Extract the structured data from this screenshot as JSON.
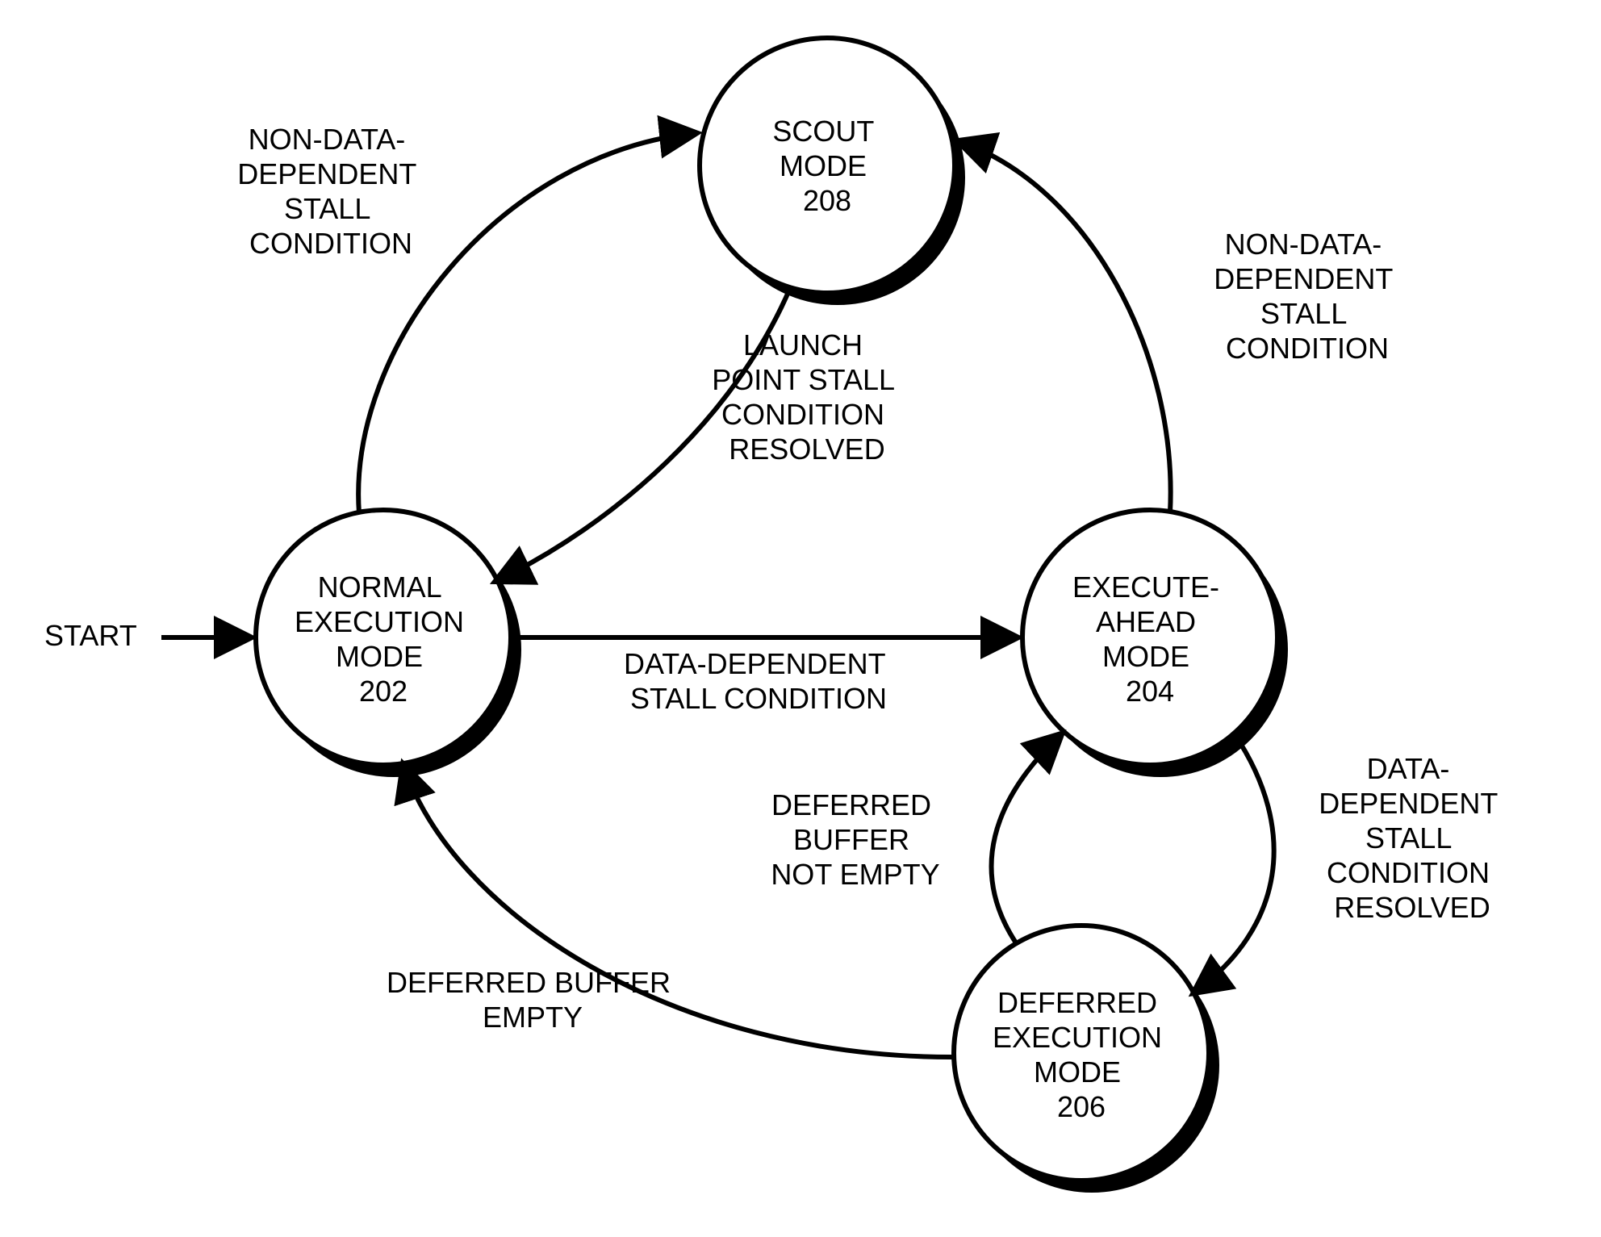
{
  "start_label": "START",
  "nodes": {
    "normal": {
      "line1": "NORMAL",
      "line2": "EXECUTION",
      "line3": "MODE",
      "line4": "202"
    },
    "execute": {
      "line1": "EXECUTE-",
      "line2": "AHEAD",
      "line3": "MODE",
      "line4": "204"
    },
    "deferred": {
      "line1": "DEFERRED",
      "line2": "EXECUTION",
      "line3": "MODE",
      "line4": "206"
    },
    "scout": {
      "line1": "SCOUT",
      "line2": "MODE",
      "line3": "208",
      "line4": ""
    }
  },
  "edges": {
    "normal_to_scout": {
      "l1": "NON-DATA-",
      "l2": "DEPENDENT",
      "l3": "STALL",
      "l4": "CONDITION"
    },
    "scout_to_normal": {
      "l1": "LAUNCH",
      "l2": "POINT STALL",
      "l3": "CONDITION",
      "l4": "RESOLVED"
    },
    "normal_to_execute": {
      "l1": "DATA-DEPENDENT",
      "l2": "STALL CONDITION",
      "l3": "",
      "l4": ""
    },
    "execute_to_scout": {
      "l1": "NON-DATA-",
      "l2": "DEPENDENT",
      "l3": "STALL",
      "l4": "CONDITION"
    },
    "execute_to_deferred": {
      "l1": "DATA-",
      "l2": "DEPENDENT",
      "l3": "STALL",
      "l4": "CONDITION",
      "l5": "RESOLVED"
    },
    "deferred_to_execute": {
      "l1": "DEFERRED",
      "l2": "BUFFER",
      "l3": "NOT EMPTY",
      "l4": ""
    },
    "deferred_to_normal": {
      "l1": "DEFERRED BUFFER",
      "l2": "EMPTY",
      "l3": "",
      "l4": ""
    }
  }
}
